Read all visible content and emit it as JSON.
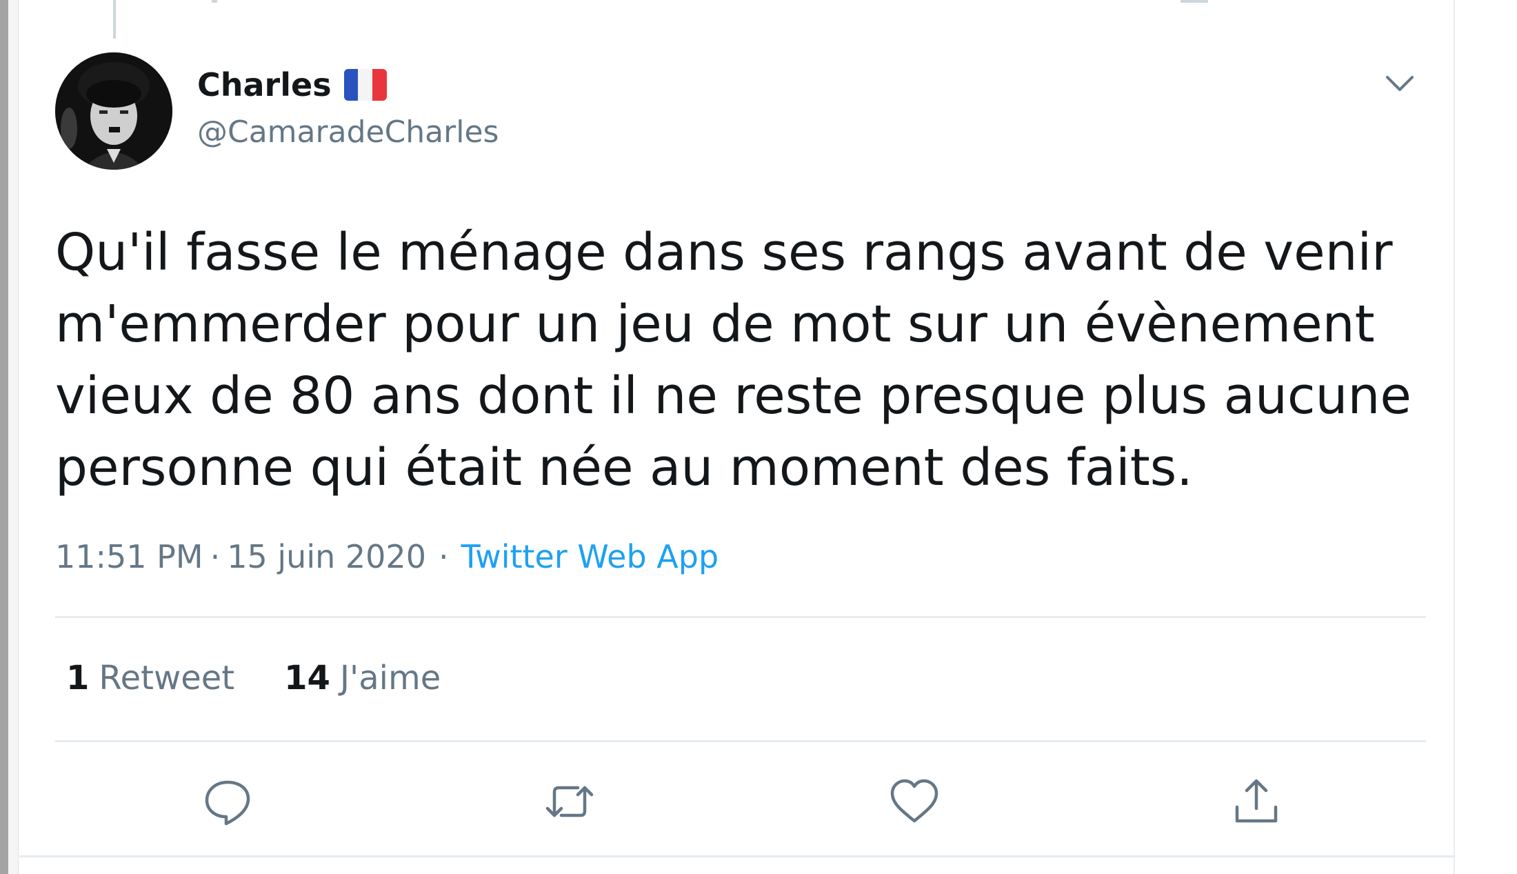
{
  "author": {
    "display_name": "Charles",
    "handle": "@CamaradeCharles",
    "flag_icon": "france-flag-icon"
  },
  "tweet": {
    "text": "Qu'il fasse le ménage dans ses rangs avant de venir\nm'emmerder pour un jeu de mot sur un évènement\nvieux de 80 ans dont il ne reste presque plus aucune\npersonne qui était née au moment des faits.",
    "time": "11:51 PM",
    "date": "15 juin 2020",
    "separator": "·",
    "source": "Twitter Web App"
  },
  "stats": {
    "retweets_count": "1",
    "retweets_label": "Retweet",
    "likes_count": "14",
    "likes_label": "J'aime"
  },
  "actions": [
    "reply-icon",
    "retweet-icon",
    "like-icon",
    "share-icon"
  ],
  "colors": {
    "text": "#14171a",
    "secondary": "#657786",
    "link": "#1da1f2",
    "border": "#e6ecf0"
  }
}
